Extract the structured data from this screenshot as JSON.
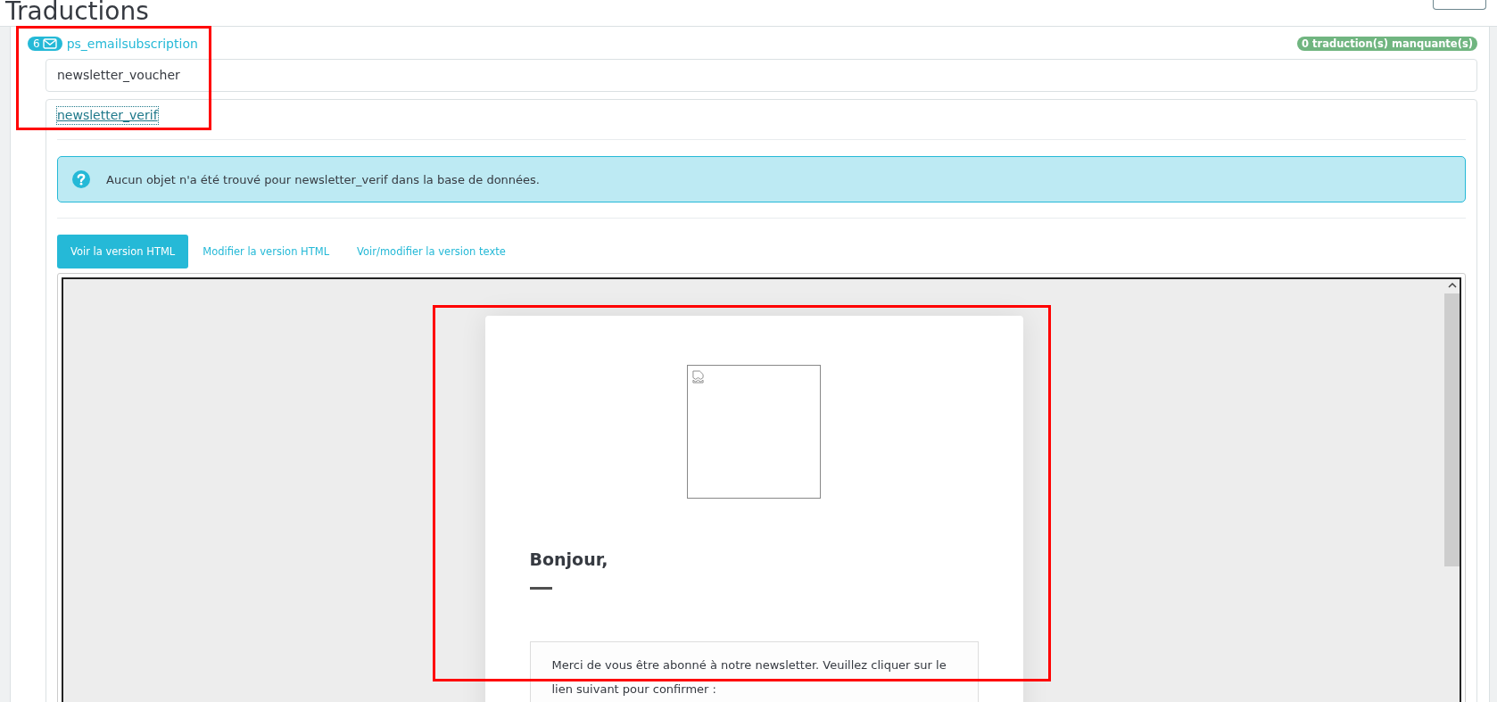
{
  "page": {
    "title": "Traductions"
  },
  "module": {
    "count": "6",
    "name": "ps_emailsubscription",
    "missing_badge": "0 traduction(s) manquante(s)"
  },
  "templates": [
    {
      "name": "newsletter_voucher",
      "expanded": false
    },
    {
      "name": "newsletter_verif",
      "expanded": true
    }
  ],
  "alert": {
    "message": "Aucun objet n'a été trouvé pour newsletter_verif dans la base de données."
  },
  "tabs": [
    {
      "label": "Voir la version HTML",
      "selected": true
    },
    {
      "label": "Modifier la version HTML",
      "selected": false
    },
    {
      "label": "Voir/modifier la version texte",
      "selected": false
    }
  ],
  "preview": {
    "heading": "Bonjour,",
    "body": "Merci de vous être abonné à notre newsletter. Veuillez cliquer sur le lien suivant pour confirmer :"
  },
  "annotation_boxes": [
    {
      "kind": "frame"
    },
    {
      "kind": "frame"
    }
  ]
}
